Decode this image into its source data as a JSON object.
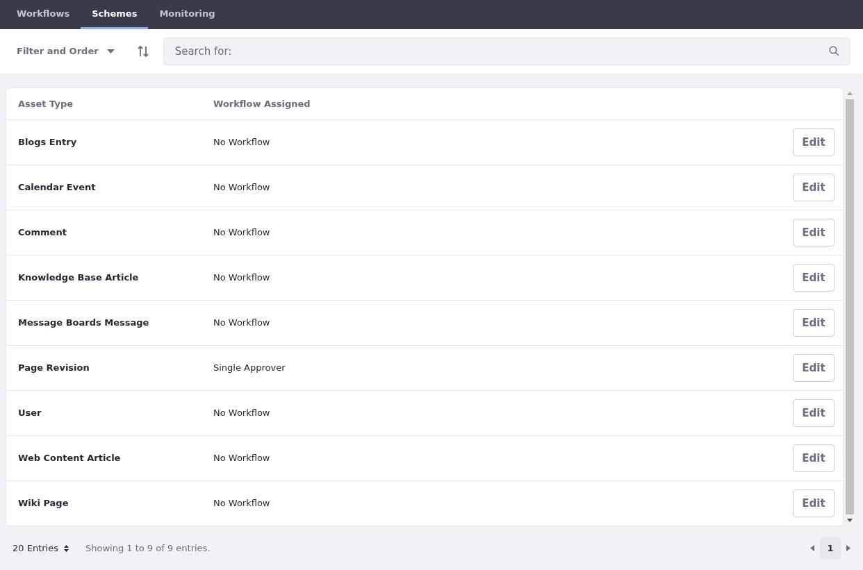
{
  "tabs": [
    {
      "label": "Workflows",
      "selected": false
    },
    {
      "label": "Schemes",
      "selected": true
    },
    {
      "label": "Monitoring",
      "selected": false
    }
  ],
  "toolbar": {
    "filter_label": "Filter and Order",
    "search": {
      "placeholder": "Search for:"
    }
  },
  "table": {
    "columns": [
      "Asset Type",
      "Workflow Assigned"
    ],
    "rows": [
      {
        "asset_type": "Blogs Entry",
        "workflow": "No Workflow",
        "action": "Edit"
      },
      {
        "asset_type": "Calendar Event",
        "workflow": "No Workflow",
        "action": "Edit"
      },
      {
        "asset_type": "Comment",
        "workflow": "No Workflow",
        "action": "Edit"
      },
      {
        "asset_type": "Knowledge Base Article",
        "workflow": "No Workflow",
        "action": "Edit"
      },
      {
        "asset_type": "Message Boards Message",
        "workflow": "No Workflow",
        "action": "Edit"
      },
      {
        "asset_type": "Page Revision",
        "workflow": "Single Approver",
        "action": "Edit"
      },
      {
        "asset_type": "User",
        "workflow": "No Workflow",
        "action": "Edit"
      },
      {
        "asset_type": "Web Content Article",
        "workflow": "No Workflow",
        "action": "Edit"
      },
      {
        "asset_type": "Wiki Page",
        "workflow": "No Workflow",
        "action": "Edit"
      }
    ]
  },
  "footer": {
    "entries": "20 Entries",
    "summary": "Showing 1 to 9 of 9 entries.",
    "pages": [
      {
        "label": "1",
        "selected": true
      }
    ]
  }
}
